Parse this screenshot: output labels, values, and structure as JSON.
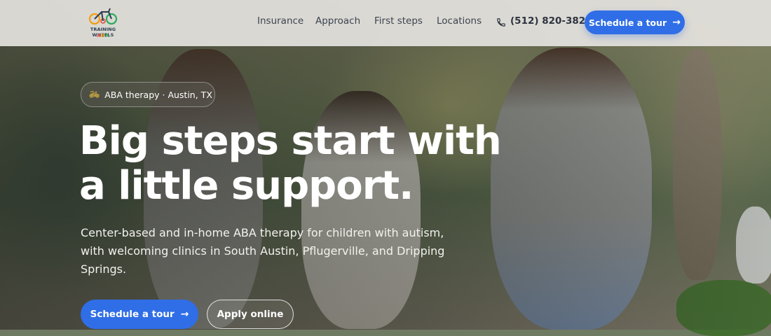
{
  "brand": {
    "logo_line1": "TRAINING WHEELS",
    "logo_line2_parts": [
      "A",
      "B",
      "A"
    ]
  },
  "nav": {
    "items": [
      {
        "label": "Insurance"
      },
      {
        "label": "Approach"
      },
      {
        "label": "First steps"
      },
      {
        "label": "Locations"
      }
    ],
    "phone": "(512) 820-3825",
    "cta_label": "Schedule a tour",
    "cta_icon": "arrow-right-icon"
  },
  "hero": {
    "badge_icon": "bicycle-icon",
    "badge_text": "ABA therapy · Austin, TX",
    "title_line1": "Big steps start with",
    "title_line2": "a little support.",
    "subtitle": "Center-based and in-home ABA therapy for children with autism, with welcoming clinics in South Austin, Pflugerville, and Dripping Springs.",
    "primary_label": "Schedule a tour",
    "secondary_label": "Apply online"
  },
  "colors": {
    "accent": "#2f6ee6",
    "header_bg": "#e4e2de",
    "nav_text": "#3b4450"
  }
}
